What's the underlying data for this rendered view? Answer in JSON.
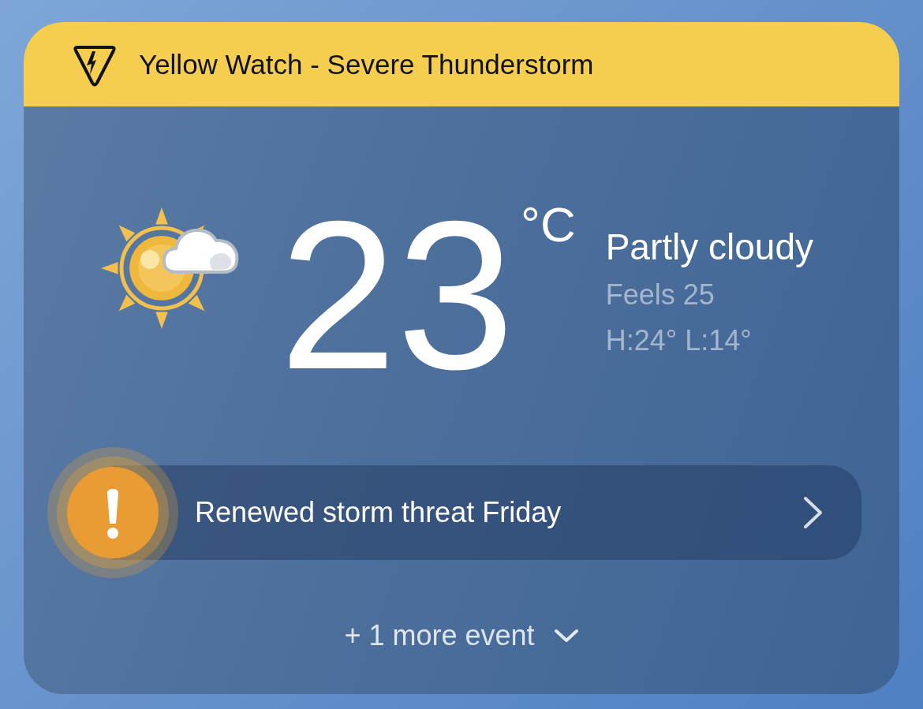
{
  "alert_banner": {
    "title": "Yellow Watch - Severe Thunderstorm"
  },
  "current": {
    "temperature": "23",
    "unit": "°C",
    "condition": "Partly cloudy",
    "feels_like": "Feels 25",
    "high_low": "H:24° L:14°"
  },
  "events": [
    {
      "title": "Renewed storm threat Friday"
    }
  ],
  "more_events": {
    "label": "+ 1 more event",
    "expanded": false
  }
}
